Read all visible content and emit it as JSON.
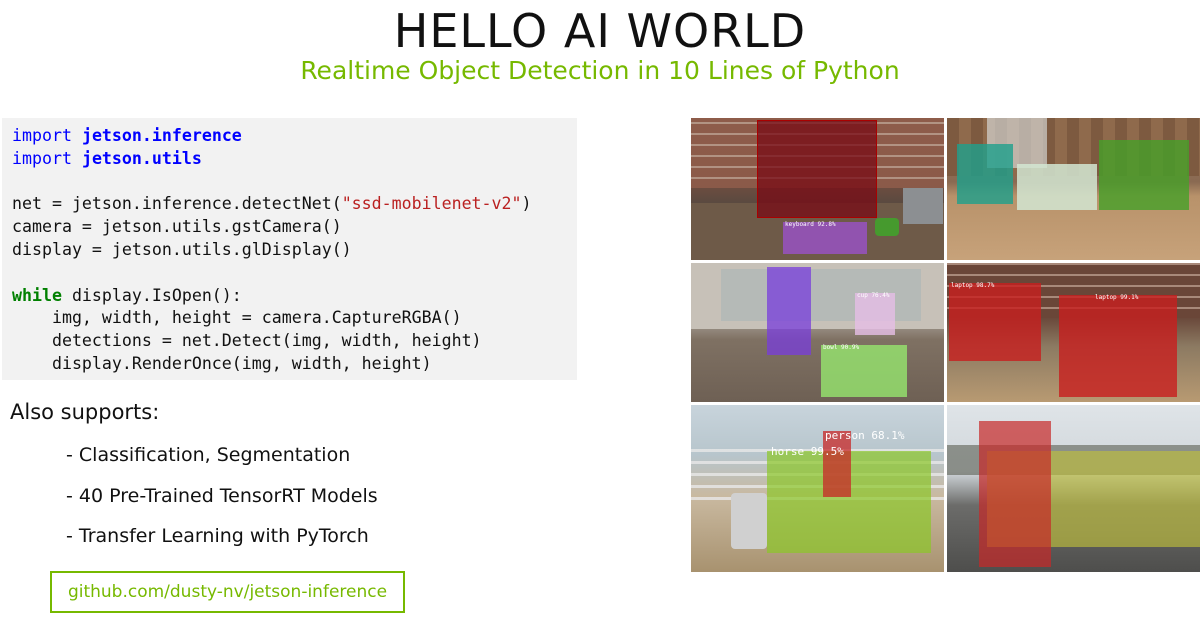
{
  "header": {
    "title": "HELLO AI WORLD",
    "subtitle": "Realtime Object Detection in 10 Lines of Python"
  },
  "code": {
    "line1_kw": "import",
    "line1_mod": "jetson.inference",
    "line2_kw": "import",
    "line2_mod": "jetson.utils",
    "line4_pre": "net = jetson.inference.detectNet(",
    "line4_str": "\"ssd-mobilenet-v2\"",
    "line4_post": ")",
    "line5": "camera = jetson.utils.gstCamera()",
    "line6": "display = jetson.utils.glDisplay()",
    "line8_kw": "while",
    "line8_rest": " display.IsOpen():",
    "line9": "    img, width, height = camera.CaptureRGBA()",
    "line10": "    detections = net.Detect(img, width, height)",
    "line11": "    display.RenderOnce(img, width, height)"
  },
  "also": {
    "heading": "Also supports:",
    "items": [
      "- Classification, Segmentation",
      "- 40 Pre-Trained TensorRT Models",
      "- Transfer Learning with PyTorch"
    ]
  },
  "link": {
    "text": "github.com/dusty-nv/jetson-inference"
  },
  "detections": {
    "keyboard": "keyboard 92.8%",
    "cup": "cup 76.4%",
    "bowl": "bowl 90.9%",
    "laptop1": "laptop 98.7%",
    "laptop2": "laptop 99.1%",
    "person": "person 68.1%",
    "horse": "horse 99.5%"
  },
  "colors": {
    "accent": "#76b900",
    "code_bg": "#f2f2f2",
    "keyword": "#008000",
    "module": "#0000ff",
    "string": "#ba2121"
  }
}
